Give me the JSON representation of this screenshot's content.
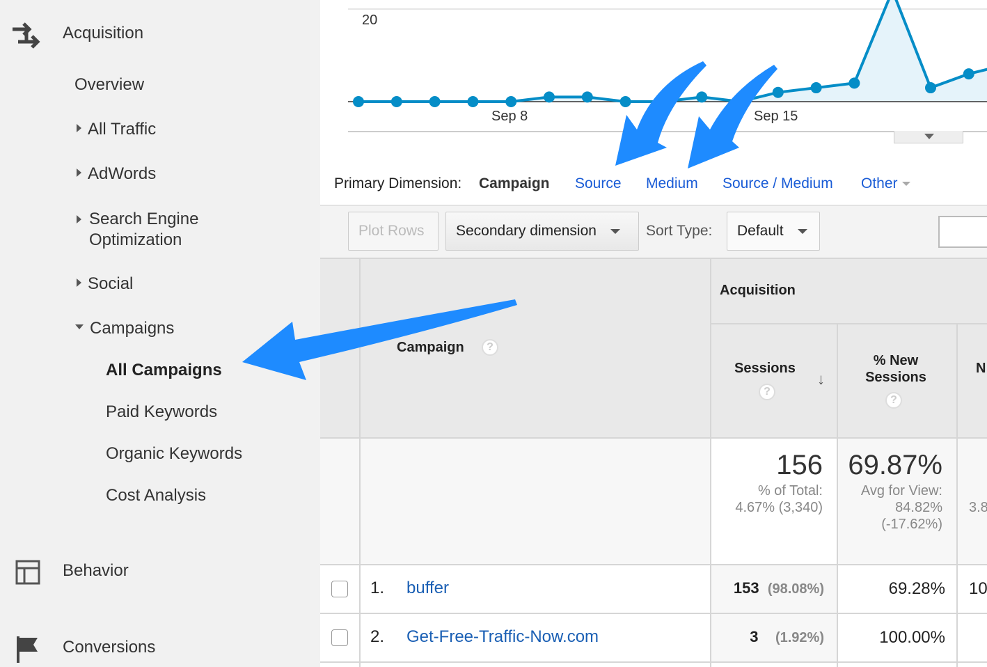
{
  "sidebar": {
    "acquisition": "Acquisition",
    "items": [
      {
        "label": "Overview"
      },
      {
        "label": "All Traffic"
      },
      {
        "label": "AdWords"
      },
      {
        "label": "Search Engine Optimization"
      },
      {
        "label": "Social"
      },
      {
        "label": "Campaigns"
      }
    ],
    "campaign_items": [
      {
        "label": "All Campaigns",
        "active": true
      },
      {
        "label": "Paid Keywords"
      },
      {
        "label": "Organic Keywords"
      },
      {
        "label": "Cost Analysis"
      }
    ],
    "behavior": "Behavior",
    "conversions": "Conversions"
  },
  "chart": {
    "y_tick": "20",
    "x_ticks": [
      "Sep 8",
      "Sep 15"
    ],
    "values": [
      0,
      0,
      0,
      0,
      0,
      1,
      1,
      0,
      0,
      1,
      0,
      2,
      3,
      4,
      24,
      3,
      6,
      8
    ],
    "line_color": "#058dc7",
    "fill_color": "#e5f3fa"
  },
  "dimension": {
    "label": "Primary Dimension:",
    "active": "Campaign",
    "options": [
      "Source",
      "Medium",
      "Source / Medium"
    ],
    "other": "Other"
  },
  "toolbar": {
    "plot_rows": "Plot Rows",
    "secondary": "Secondary dimension",
    "sort_label": "Sort Type:",
    "sort_value": "Default"
  },
  "table": {
    "group": "Acquisition",
    "campaign_header": "Campaign",
    "sessions_header": "Sessions",
    "new_sessions_header": "% New Sessions",
    "next_header_partial": "N",
    "totals": {
      "sessions": "156",
      "sessions_sub1": "% of Total:",
      "sessions_sub2": "4.67% (3,340)",
      "new_sessions": "69.87%",
      "new_sub1": "Avg for View:",
      "new_sub2": "84.82%",
      "new_sub3": "(-17.62%)",
      "next_partial": "3.8"
    },
    "rows": [
      {
        "num": "1.",
        "campaign": "buffer",
        "sessions": "153",
        "sessions_pct": "(98.08%)",
        "new_sessions": "69.28%",
        "next_partial": "10"
      },
      {
        "num": "2.",
        "campaign": "Get-Free-Traffic-Now.com",
        "sessions": "3",
        "sessions_pct": "(1.92%)",
        "new_sessions": "100.00%",
        "next_partial": ""
      }
    ]
  },
  "annotation_color": "#1e8bff"
}
